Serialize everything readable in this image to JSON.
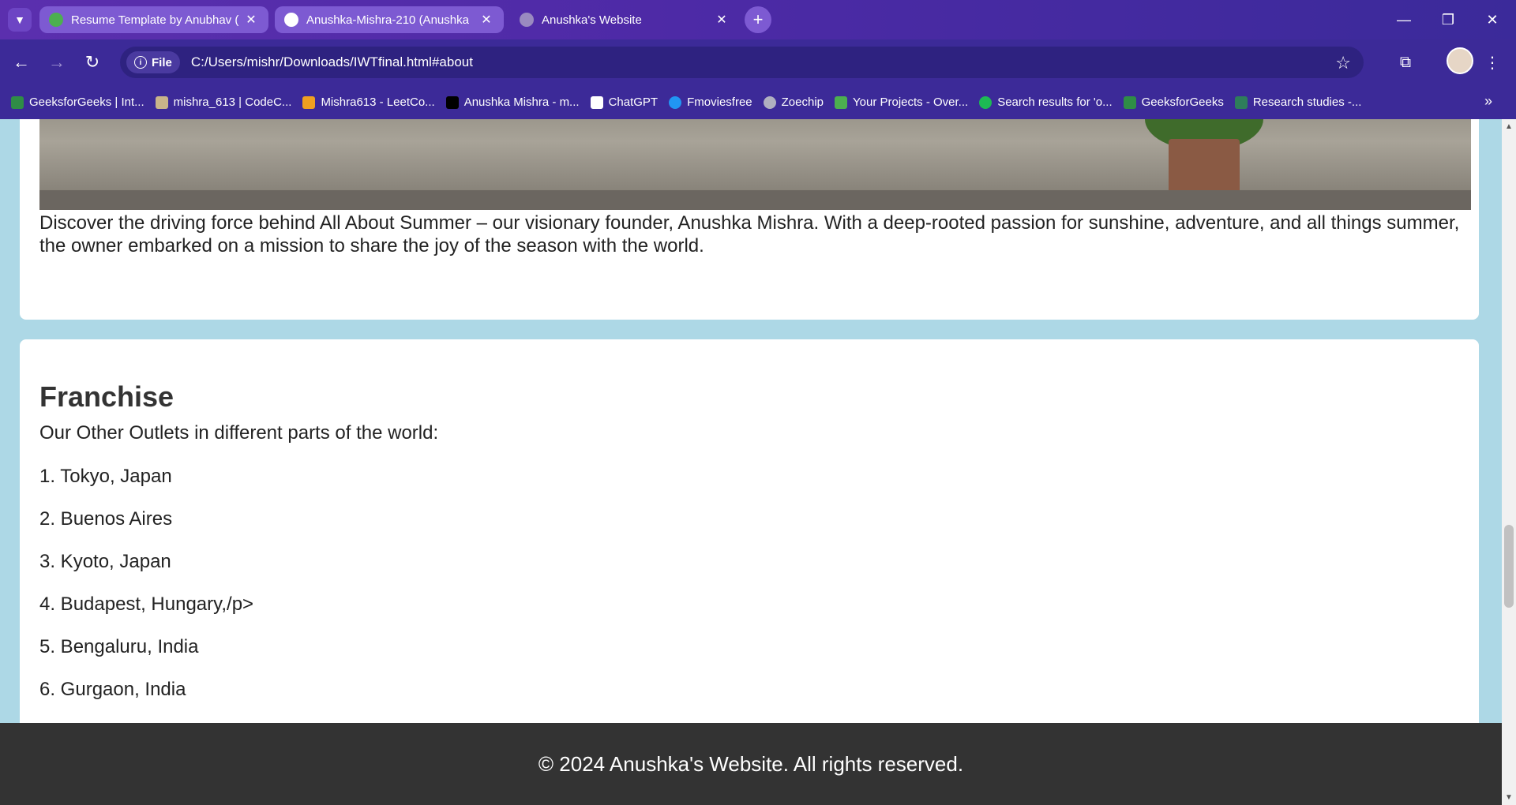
{
  "browser": {
    "tabs": [
      {
        "title": "Resume Template by Anubhav (",
        "favicon_color": "#4caf50"
      },
      {
        "title": "Anushka-Mishra-210 (Anushka",
        "favicon_color": "#ffffff"
      },
      {
        "title": "Anushka's Website",
        "favicon_color": "#9a8ac0"
      }
    ],
    "address": {
      "chip_label": "File",
      "url": "C:/Users/mishr/Downloads/IWTfinal.html#about"
    },
    "bookmarks": [
      {
        "label": "GeeksforGeeks | Int...",
        "color": "#2f8d46"
      },
      {
        "label": "mishra_613 | CodeC...",
        "color": "#c9b48a"
      },
      {
        "label": "Mishra613 - LeetCo...",
        "color": "#f0a020"
      },
      {
        "label": "Anushka Mishra - m...",
        "color": "#000000"
      },
      {
        "label": "ChatGPT",
        "color": "#ffffff"
      },
      {
        "label": "Fmoviesfree",
        "color": "#2196f3"
      },
      {
        "label": "Zoechip",
        "color": "#b0b0c0"
      },
      {
        "label": "Your Projects - Over...",
        "color": "#4caf50"
      },
      {
        "label": "Search results for 'o...",
        "color": "#1db954"
      },
      {
        "label": "GeeksforGeeks",
        "color": "#2f8d46"
      },
      {
        "label": "Research studies -...",
        "color": "#2e7d5b"
      }
    ]
  },
  "page": {
    "about_text": "Discover the driving force behind All About Summer – our visionary founder, Anushka Mishra. With a deep-rooted passion for sunshine, adventure, and all things summer, the owner embarked on a mission to share the joy of the season with the world.",
    "franchise": {
      "title": "Franchise",
      "intro": "Our Other Outlets in different parts of the world:",
      "outlets": [
        "1. Tokyo, Japan",
        "2. Buenos Aires",
        "3. Kyoto, Japan",
        "4. Budapest, Hungary,/p>",
        "5. Bengaluru, India",
        "6. Gurgaon, India"
      ]
    },
    "footer": "© 2024 Anushka's Website. All rights reserved."
  }
}
